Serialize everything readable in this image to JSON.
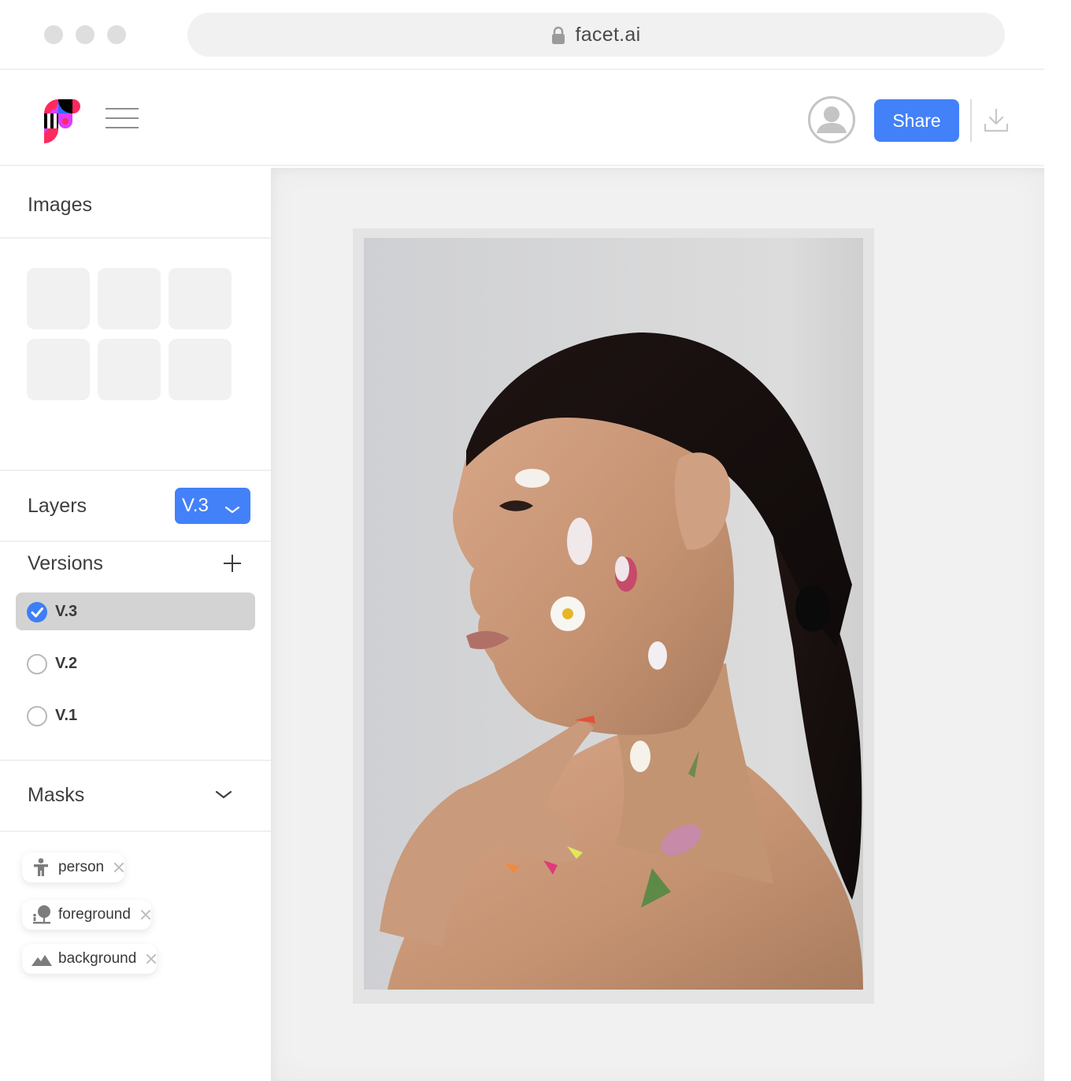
{
  "browser": {
    "url": "facet.ai",
    "window_dots": [
      "close",
      "minimize",
      "maximize"
    ],
    "lock_icon": "lock-icon"
  },
  "header": {
    "logo": "facet-logo",
    "menu_icon": "hamburger-menu-icon",
    "avatar_icon": "user-avatar-icon",
    "share_label": "Share",
    "download_icon": "download-icon"
  },
  "sidebar": {
    "images": {
      "title": "Images",
      "thumbnails": [
        "",
        "",
        "",
        "",
        "",
        ""
      ]
    },
    "layers": {
      "title": "Layers",
      "selected_version": "V.3",
      "dropdown_icon": "chevron-down-icon"
    },
    "versions": {
      "title": "Versions",
      "add_icon": "plus-icon",
      "items": [
        {
          "label": "V.3",
          "selected": true
        },
        {
          "label": "V.2",
          "selected": false
        },
        {
          "label": "V.1",
          "selected": false
        }
      ]
    },
    "masks": {
      "title": "Masks",
      "toggle_icon": "chevron-down-icon",
      "chips": [
        {
          "label": "person",
          "icon": "person-icon"
        },
        {
          "label": "foreground",
          "icon": "foreground-icon"
        },
        {
          "label": "background",
          "icon": "mountain-icon"
        }
      ]
    }
  },
  "canvas": {
    "image_description": "Portrait of a woman in profile with small flowers placed on her face and neck"
  },
  "colors": {
    "accent": "#4381f9",
    "check": "#3d7ef7",
    "canvas_bg": "#f1f1f1",
    "selected_row": "#d3d3d3"
  }
}
